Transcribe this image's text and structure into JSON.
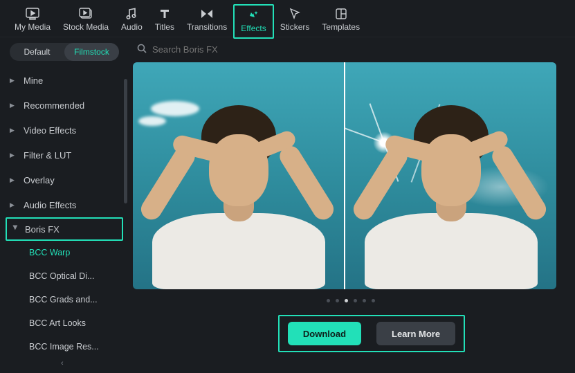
{
  "topnav": {
    "items": [
      {
        "label": "My Media",
        "icon": "my-media-icon"
      },
      {
        "label": "Stock Media",
        "icon": "stock-media-icon"
      },
      {
        "label": "Audio",
        "icon": "audio-icon"
      },
      {
        "label": "Titles",
        "icon": "titles-icon"
      },
      {
        "label": "Transitions",
        "icon": "transitions-icon"
      },
      {
        "label": "Effects",
        "icon": "effects-icon",
        "active": true
      },
      {
        "label": "Stickers",
        "icon": "stickers-icon"
      },
      {
        "label": "Templates",
        "icon": "templates-icon"
      }
    ]
  },
  "sidebar": {
    "tabs": [
      {
        "label": "Default"
      },
      {
        "label": "Filmstock",
        "active": true
      }
    ],
    "categories": [
      {
        "label": "Mine"
      },
      {
        "label": "Recommended"
      },
      {
        "label": "Video Effects"
      },
      {
        "label": "Filter & LUT"
      },
      {
        "label": "Overlay"
      },
      {
        "label": "Audio Effects"
      },
      {
        "label": "Boris FX",
        "selected": true,
        "expanded": true
      }
    ],
    "sub_items": [
      {
        "label": "BCC Warp"
      },
      {
        "label": "BCC Optical Di..."
      },
      {
        "label": "BCC Grads and..."
      },
      {
        "label": "BCC Art Looks"
      },
      {
        "label": "BCC Image Res..."
      }
    ]
  },
  "search": {
    "placeholder": "Search Boris FX"
  },
  "carousel": {
    "count": 6,
    "active_index": 2
  },
  "cta": {
    "download": "Download",
    "learn_more": "Learn More"
  }
}
